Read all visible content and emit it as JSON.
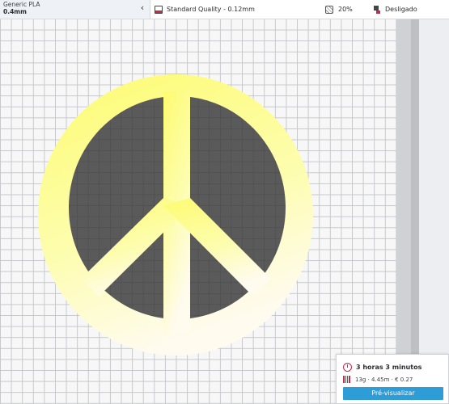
{
  "material": {
    "name": "Generic PLA",
    "nozzle": "0.4mm"
  },
  "quality": {
    "label": "Standard Quality - 0.12mm"
  },
  "infill": {
    "value": "20%"
  },
  "support": {
    "label": "Desligado"
  },
  "print_summary": {
    "time": "3 horas 3 minutos",
    "stats": "13g · 4.45m · € 0.27",
    "preview_button": "Pré-visualizar"
  },
  "colors": {
    "accent": "#c62a4b",
    "preview_button": "#2d9cd7",
    "model_fill_top": "#fdfc79",
    "model_fill_bottom": "#fffbe6",
    "hole_fill": "#595959"
  },
  "icons": {
    "collapse": "chevron-left-icon",
    "quality": "quality-icon",
    "infill": "infill-icon",
    "support": "support-icon",
    "time": "clock-icon",
    "stats": "spool-icon"
  }
}
